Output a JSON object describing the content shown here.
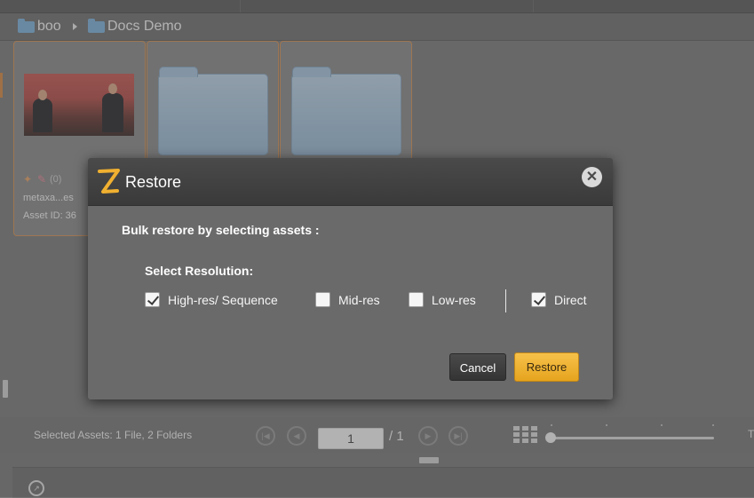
{
  "breadcrumb": {
    "items": [
      {
        "label": "boo",
        "icon": "folder-icon"
      },
      {
        "label": "Docs Demo",
        "icon": "folder-icon"
      }
    ],
    "separator_icon": "chevron-right-icon"
  },
  "assets": {
    "cards": [
      {
        "type": "image",
        "name": "metaxa...es",
        "id_label": "Asset ID: 36",
        "badges": [
          "pin-icon",
          "tag-icon"
        ],
        "count": "(0)"
      },
      {
        "type": "folder"
      },
      {
        "type": "folder"
      }
    ]
  },
  "footer_bar": {
    "selected_assets": "Selected Assets: 1 File, 2 Folders",
    "page_value": "1",
    "page_total": "/ 1",
    "edge_letter": "T",
    "icons": [
      "first-page-icon",
      "prev-page-icon",
      "next-page-icon",
      "last-page-icon",
      "grid-view-icon",
      "zoom-slider"
    ]
  },
  "dialog": {
    "title": "Restore",
    "logo": "Z",
    "heading": "Bulk restore by selecting assets :",
    "resolution_label": "Select Resolution:",
    "options": [
      {
        "label": "High-res/ Sequence",
        "checked": true
      },
      {
        "label": "Mid-res",
        "checked": false
      },
      {
        "label": "Low-res",
        "checked": false
      },
      {
        "label": "Direct",
        "checked": true
      }
    ],
    "cancel_label": "Cancel",
    "restore_label": "Restore",
    "close_icon": "close-icon"
  },
  "colors": {
    "accent": "#f0b030",
    "selected_border": "#d4945a",
    "folder": "#7fb2dc",
    "dialog_header": "#3f3f3f"
  }
}
